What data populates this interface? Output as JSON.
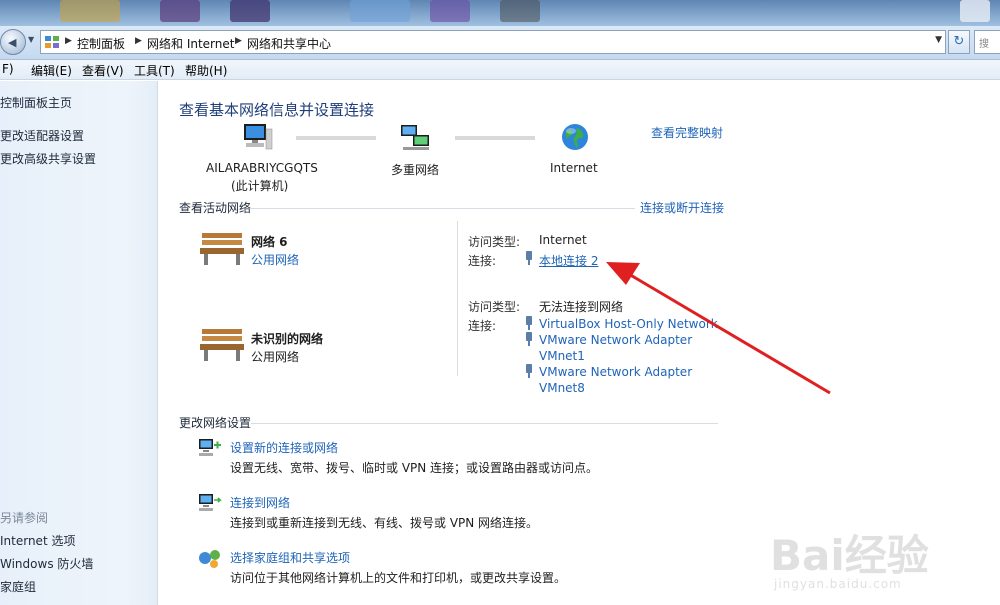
{
  "address": {
    "crumbs": [
      "控制面板",
      "网络和 Internet",
      "网络和共享中心"
    ]
  },
  "menu": {
    "items": [
      "F)",
      "编辑(E)",
      "查看(V)",
      "工具(T)",
      "帮助(H)"
    ]
  },
  "sidebar": {
    "links": [
      "控制面板主页",
      "更改适配器设置",
      "更改高级共享设置"
    ],
    "see_also_label": "另请参阅",
    "see_also": [
      "Internet 选项",
      "Windows 防火墙",
      "家庭组"
    ]
  },
  "main": {
    "title": "查看基本网络信息并设置连接",
    "view_full_map": "查看完整映射",
    "map": {
      "computer_name": "AILARABRIYCGQTS",
      "computer_sub": "(此计算机)",
      "middle": "多重网络",
      "internet": "Internet"
    },
    "active_label": "查看活动网络",
    "connect_disconnect": "连接或断开连接",
    "networks": [
      {
        "name": "网络  6",
        "type": "公用网络",
        "access_label": "访问类型:",
        "access_value": "Internet",
        "conn_label": "连接:",
        "connections": [
          "本地连接 2"
        ]
      },
      {
        "name": "未识别的网络",
        "type": "公用网络",
        "access_label": "访问类型:",
        "access_value": "无法连接到网络",
        "conn_label": "连接:",
        "connections": [
          "VirtualBox Host-Only Network",
          "VMware Network Adapter",
          "VMnet1",
          "VMware Network Adapter",
          "VMnet8"
        ]
      }
    ],
    "change_label": "更改网络设置",
    "tasks": [
      {
        "title": "设置新的连接或网络",
        "desc": "设置无线、宽带、拨号、临时或 VPN 连接；或设置路由器或访问点。"
      },
      {
        "title": "连接到网络",
        "desc": "连接到或重新连接到无线、有线、拨号或 VPN 网络连接。"
      },
      {
        "title": "选择家庭组和共享选项",
        "desc": "访问位于其他网络计算机上的文件和打印机，或更改共享设置。"
      }
    ]
  },
  "watermark": {
    "brand": "Bai经验",
    "url": "jingyan.baidu.com"
  },
  "colors": {
    "link": "#1f64b8",
    "title": "#1f3e79",
    "arrow": "#e02020"
  }
}
